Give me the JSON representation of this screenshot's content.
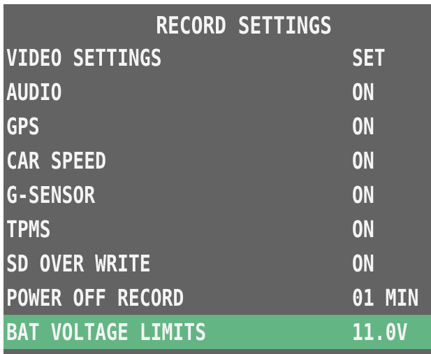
{
  "menu": {
    "title": "RECORD SETTINGS",
    "items": [
      {
        "label": "VIDEO SETTINGS",
        "value": "SET"
      },
      {
        "label": "AUDIO",
        "value": "ON"
      },
      {
        "label": "GPS",
        "value": "ON"
      },
      {
        "label": "CAR SPEED",
        "value": "ON"
      },
      {
        "label": "G-SENSOR",
        "value": "ON"
      },
      {
        "label": "TPMS",
        "value": "ON"
      },
      {
        "label": "SD OVER WRITE",
        "value": "ON"
      },
      {
        "label": "POWER OFF RECORD",
        "value": "01  MIN"
      },
      {
        "label": "BAT VOLTAGE LIMITS",
        "value": "11.0V",
        "selected": true
      }
    ],
    "colors": {
      "background": "#636363",
      "highlight": "#64b584",
      "text": "#f4f4f4"
    }
  }
}
